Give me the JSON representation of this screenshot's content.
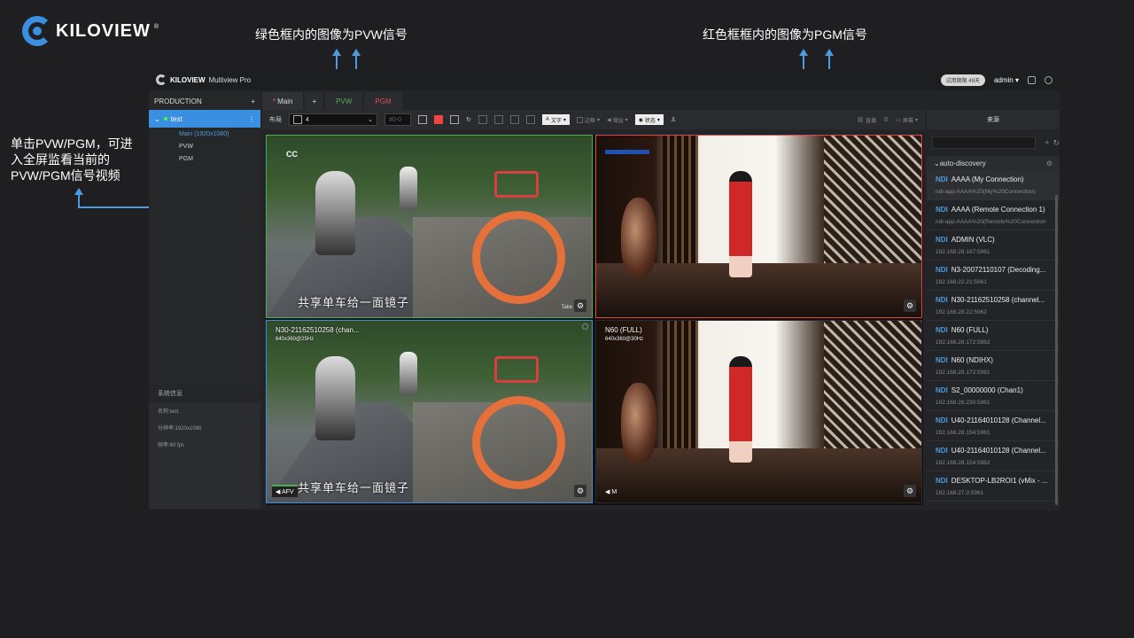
{
  "annotations": {
    "pvw_note": "绿色框内的图像为PVW信号",
    "pgm_note": "红色框框内的图像为PGM信号",
    "click_note_1": "单击PVW/PGM，可进",
    "click_note_2": "入全屏监看当前的",
    "click_note_3": "PVW/PGM信号视频"
  },
  "logo": {
    "text": "KILOVIEW",
    "reg": "®"
  },
  "app": {
    "brand_small": "KILOVIEW",
    "title": "Multiview Pro",
    "trial": "试用期限 49天",
    "user": "admin ▾"
  },
  "left": {
    "production_label": "PRODUCTION",
    "add": "+",
    "production": "test",
    "menu": "⋮",
    "subitems": [
      "Main (1920x1080)",
      "PVW",
      "PGM"
    ],
    "sysinfo_title": "系统信息",
    "sysinfo": [
      "名称:test",
      "分辨率:1920x1080",
      "帧率:60 fps"
    ]
  },
  "tabs": {
    "main": "Main",
    "add": "+",
    "pvw": "PVW",
    "pgm": "PGM"
  },
  "toolbar": {
    "layout_label": "布局",
    "layout_value": "4",
    "preset": "#0-0",
    "text_btn": "文字",
    "border_btn": "边框",
    "volume_btn": "增益",
    "status_btn": "状态",
    "live_btn": "直播",
    "screen_btn": "屏幕"
  },
  "cells": {
    "pvw_take": "Take",
    "caption": "共享单车给一面镜子",
    "bl_title": "N30-21162510258 (chan...",
    "bl_res": "640x360@25Hz",
    "bl_audio": "AFV",
    "br_title": "N60 (FULL)",
    "br_res": "640x360@30Hz",
    "br_audio": "M",
    "gear": "⚙"
  },
  "sources": {
    "title": "来源",
    "folder": "auto-discovery",
    "items": [
      {
        "tag": "NDI",
        "name": "AAAA (My Connection)",
        "addr": "ndi-app:AAAA%20(My%20Connection)"
      },
      {
        "tag": "NDI",
        "name": "AAAA (Remote Connection 1)",
        "addr": "ndi-app:AAAA%20(Remote%20Connection"
      },
      {
        "tag": "NDI",
        "name": "ADMIN (VLC)",
        "addr": "192.168.28.167:5961"
      },
      {
        "tag": "NDI",
        "name": "N3-20072110107 (Decoding...",
        "addr": "192.168.22.21:5961"
      },
      {
        "tag": "NDI",
        "name": "N30-21162510258 (channel...",
        "addr": "192.168.28.22:5962"
      },
      {
        "tag": "NDI",
        "name": "N60 (FULL)",
        "addr": "192.168.28.172:5962"
      },
      {
        "tag": "NDI",
        "name": "N60 (NDIHX)",
        "addr": "192.168.28.172:5981"
      },
      {
        "tag": "NDI",
        "name": "S2_00000000 (Chan1)",
        "addr": "192.168.28.230:5961"
      },
      {
        "tag": "NDI",
        "name": "U40-21164010128 (Channel...",
        "addr": "192.168.28.154:5961"
      },
      {
        "tag": "NDI",
        "name": "U40-21164010128 (Channel...",
        "addr": "192.168.28.154:5962"
      },
      {
        "tag": "NDI",
        "name": "DESKTOP-LB2ROI1 (vMix - ...",
        "addr": "192.168.27.3:5961"
      }
    ]
  },
  "colors": {
    "accent": "#3a8fe0",
    "pvw": "#4caf50",
    "pgm": "#e04848"
  }
}
